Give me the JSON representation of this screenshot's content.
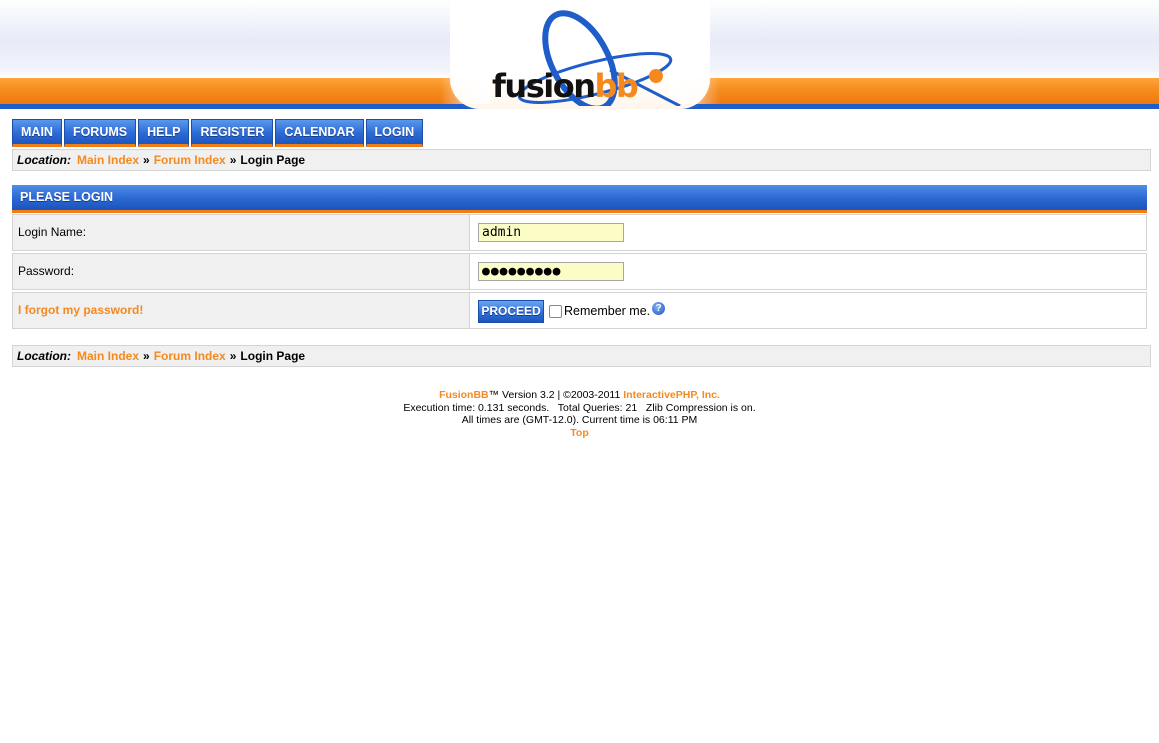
{
  "header": {
    "logo_part1": "fusion",
    "logo_part2": "bb"
  },
  "nav": {
    "items": [
      "MAIN",
      "FORUMS",
      "HELP",
      "REGISTER",
      "CALENDAR",
      "LOGIN"
    ]
  },
  "location": {
    "label": "Location:",
    "crumbs": [
      "Main Index",
      "Forum Index"
    ],
    "separator": "»",
    "current": "Login Page"
  },
  "login": {
    "heading": "PLEASE LOGIN",
    "name_label": "Login Name:",
    "name_value": "admin",
    "password_label": "Password:",
    "password_value": "●●●●●●●●●",
    "forgot_link": "I forgot my password!",
    "proceed_label": "PROCEED",
    "remember_label": "Remember me.",
    "help_glyph": "?"
  },
  "footer": {
    "brand": "FusionBB",
    "version_text": "™ Version 3.2 | ©2003-2011 ",
    "company": "InteractivePHP, Inc.",
    "stats": "Execution time: 0.131 seconds.   Total Queries: 21   Zlib Compression is on.",
    "time": "All times are (GMT-12.0). Current time is 06:11 PM",
    "top_link": "Top"
  },
  "colors": {
    "accent_orange": "#f5891e",
    "nav_blue": "#2c6ad6",
    "input_bg": "#fbfcc6"
  }
}
